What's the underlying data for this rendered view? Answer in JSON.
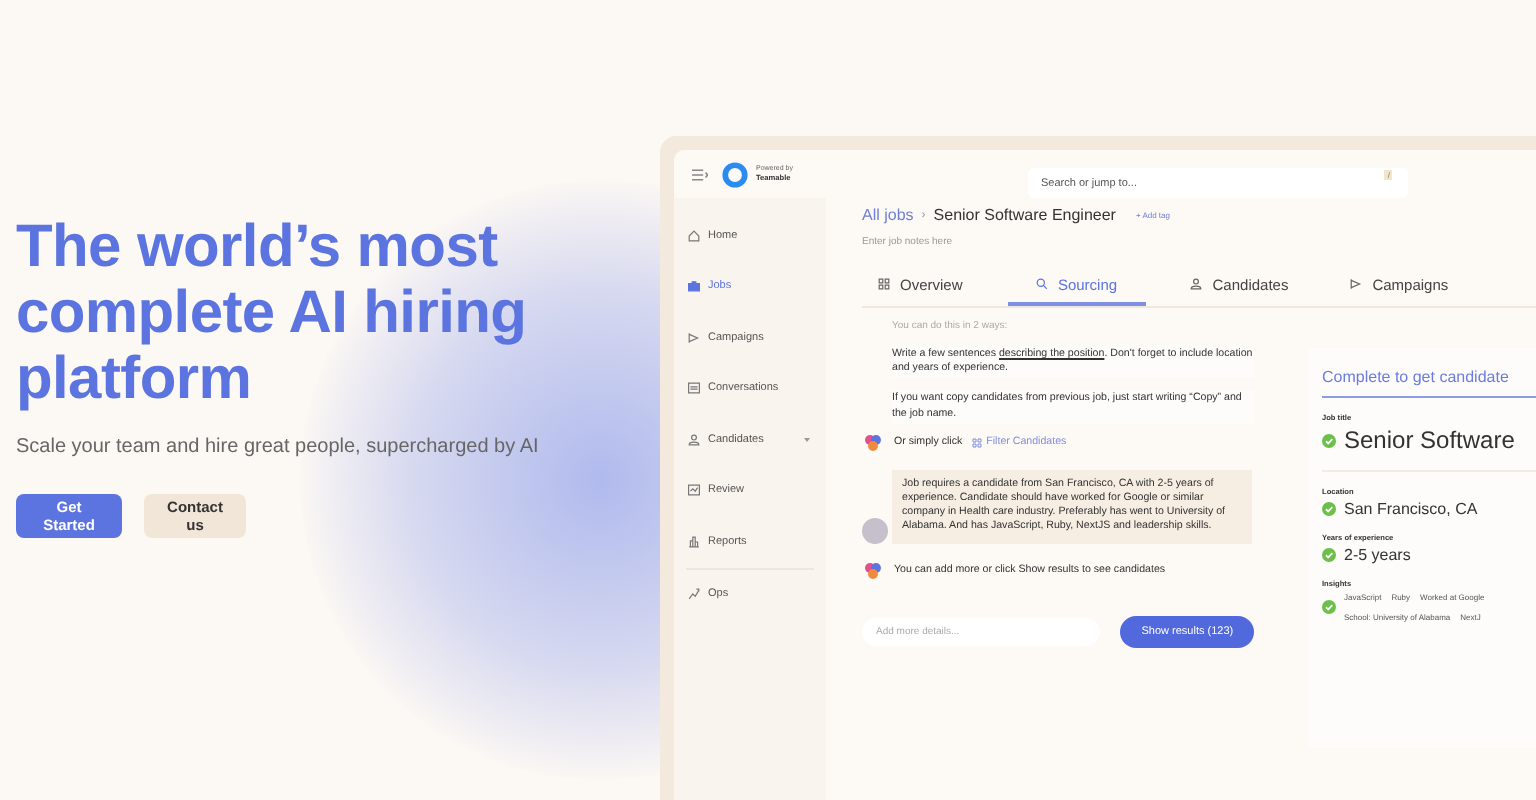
{
  "hero": {
    "headline": "The world’s most complete AI hiring platform",
    "subtitle": "Scale your team and hire great people, supercharged by AI",
    "buttons": [
      {
        "label": "Get Started",
        "kind": "primary"
      },
      {
        "label": "Contact us",
        "kind": "secondary"
      }
    ]
  },
  "app": {
    "brand": {
      "powered_by": "Powered by",
      "company": "Teamable"
    },
    "search": {
      "placeholder": "Search or jump to...",
      "shortcut": "/"
    },
    "sidebar": {
      "items": [
        {
          "label": "Home",
          "selected": false
        },
        {
          "label": "Jobs",
          "selected": true
        },
        {
          "label": "Campaigns",
          "selected": false
        },
        {
          "label": "Conversations",
          "selected": false
        },
        {
          "label": "Candidates",
          "selected": false,
          "expandable": true
        },
        {
          "label": "Review",
          "selected": false
        },
        {
          "label": "Reports",
          "selected": false
        }
      ],
      "bottom_items": [
        {
          "label": "Ops",
          "selected": false
        }
      ]
    },
    "breadcrumb": {
      "parent": "All jobs",
      "separator": "›",
      "current": "Senior Software Engineer",
      "add_tag": "+ Add tag"
    },
    "notes_placeholder": "Enter job notes here",
    "tabs": [
      {
        "label": "Overview",
        "selected": false
      },
      {
        "label": "Sourcing",
        "selected": true
      },
      {
        "label": "Candidates",
        "selected": false
      },
      {
        "label": "Campaigns",
        "selected": false
      }
    ],
    "chat": [
      {
        "kind": "faded",
        "text": "You can do this in 2 ways:"
      },
      {
        "kind": "instruction",
        "before": "Write a few sentences ",
        "underlined": "describing the position",
        "after": ". Don't forget to include location and years of experience."
      },
      {
        "kind": "instruction",
        "before": "If you want copy candidates from previous job, just start writing “Copy” and the job name."
      },
      {
        "kind": "bot",
        "text": "Or simply click",
        "link": "Filter Candidates"
      },
      {
        "kind": "user",
        "text": "Job requires a candidate from San Francisco, CA with 2-5 years of experience. Candidate should have worked for Google or similar company in Health care industry. Preferably has went to University of Alabama. And has JavaScript, Ruby, NextJS and leadership skills."
      },
      {
        "kind": "bot",
        "text": "You can add more or click Show results to see candidates"
      }
    ],
    "input": {
      "placeholder": "Add more details...",
      "button": "Show results (123)"
    },
    "summary": {
      "title": "Complete to get candidate",
      "fields": [
        {
          "label": "Job title",
          "value": "Senior Software",
          "done": true
        },
        {
          "label": "Location",
          "value": "San Francisco, CA",
          "done": true
        },
        {
          "label": "Years of experience",
          "value": "2-5 years",
          "done": true
        }
      ],
      "insights": {
        "label": "Insights",
        "done": true,
        "tags": [
          "JavaScript",
          "Ruby",
          "Worked at Google",
          "School: University of Alabama",
          "NextJ"
        ]
      }
    }
  }
}
